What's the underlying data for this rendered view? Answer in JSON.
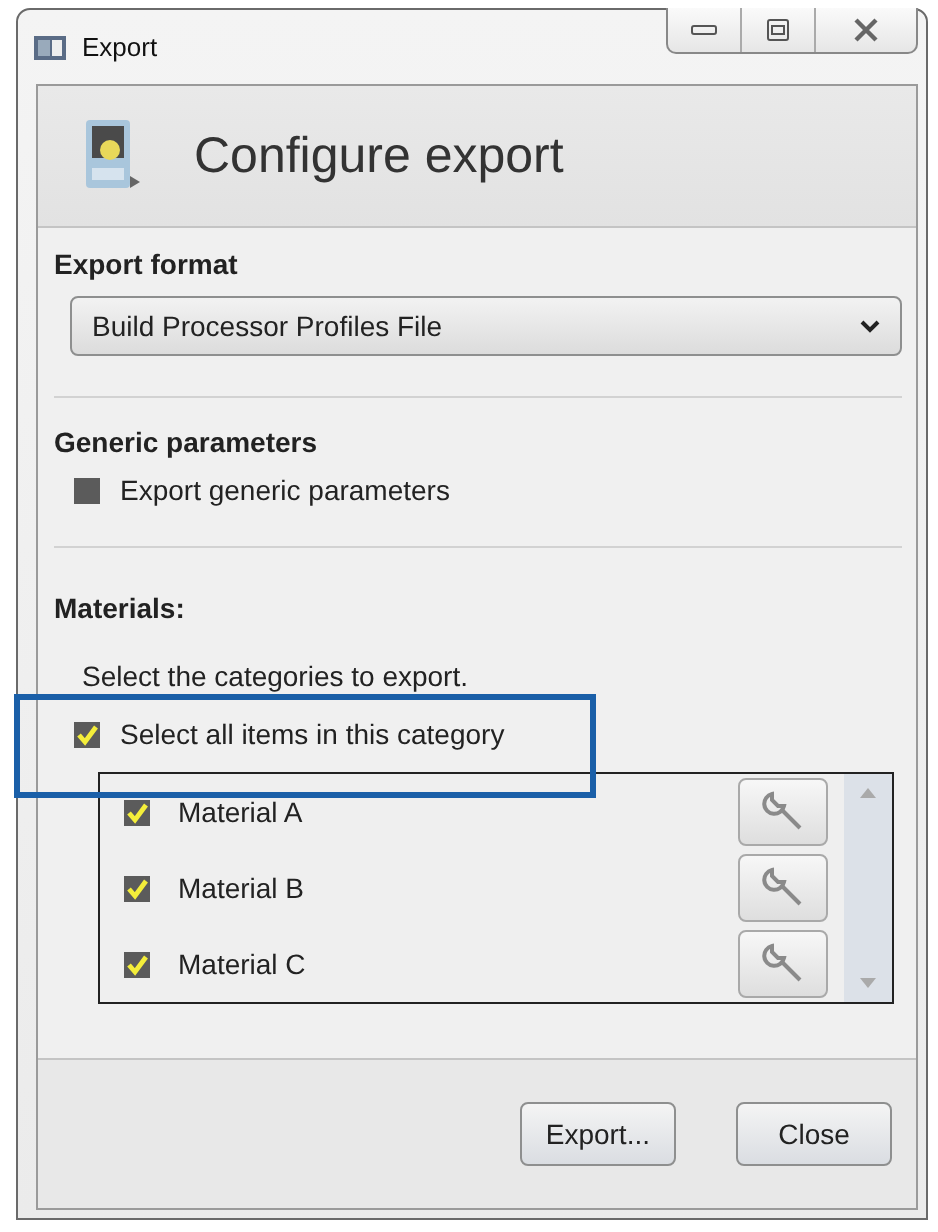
{
  "window": {
    "title": "Export"
  },
  "header": {
    "title": "Configure export"
  },
  "export_format": {
    "label": "Export format",
    "value": "Build Processor Profiles File"
  },
  "generic_parameters": {
    "label": "Generic parameters",
    "option": {
      "label": "Export generic parameters",
      "checked": false
    }
  },
  "materials": {
    "label": "Materials:",
    "hint": "Select the categories to export.",
    "select_all": {
      "label": "Select all items in this category",
      "checked": true,
      "highlighted": true
    },
    "items": [
      {
        "label": "Material A",
        "checked": true
      },
      {
        "label": "Material B",
        "checked": true
      },
      {
        "label": "Material C",
        "checked": true
      }
    ]
  },
  "buttons": [
    "Export...",
    "Close"
  ]
}
